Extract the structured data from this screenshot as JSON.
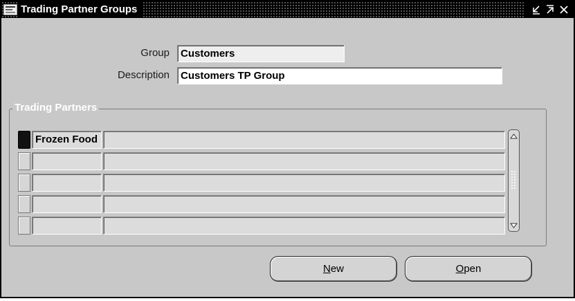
{
  "window": {
    "title": "Trading Partner Groups",
    "icon": "oracle-app-icon",
    "controls": [
      "minimize-icon",
      "maximize-icon",
      "close-icon"
    ]
  },
  "form": {
    "group_label": "Group",
    "group_value": "Customers",
    "description_label": "Description",
    "description_value": "Customers TP Group"
  },
  "trading_partners": {
    "title": "Trading Partners",
    "rows": [
      {
        "name": "Frozen Food",
        "description": "",
        "current": true
      },
      {
        "name": "",
        "description": "",
        "current": false
      },
      {
        "name": "",
        "description": "",
        "current": false
      },
      {
        "name": "",
        "description": "",
        "current": false
      },
      {
        "name": "",
        "description": "",
        "current": false
      }
    ]
  },
  "buttons": {
    "new_mnemonic": "N",
    "new_rest": "ew",
    "open_mnemonic": "O",
    "open_rest": "pen"
  },
  "colors": {
    "background": "#c8c8c8",
    "titlebar": "#000000",
    "current_record": "#111111"
  }
}
